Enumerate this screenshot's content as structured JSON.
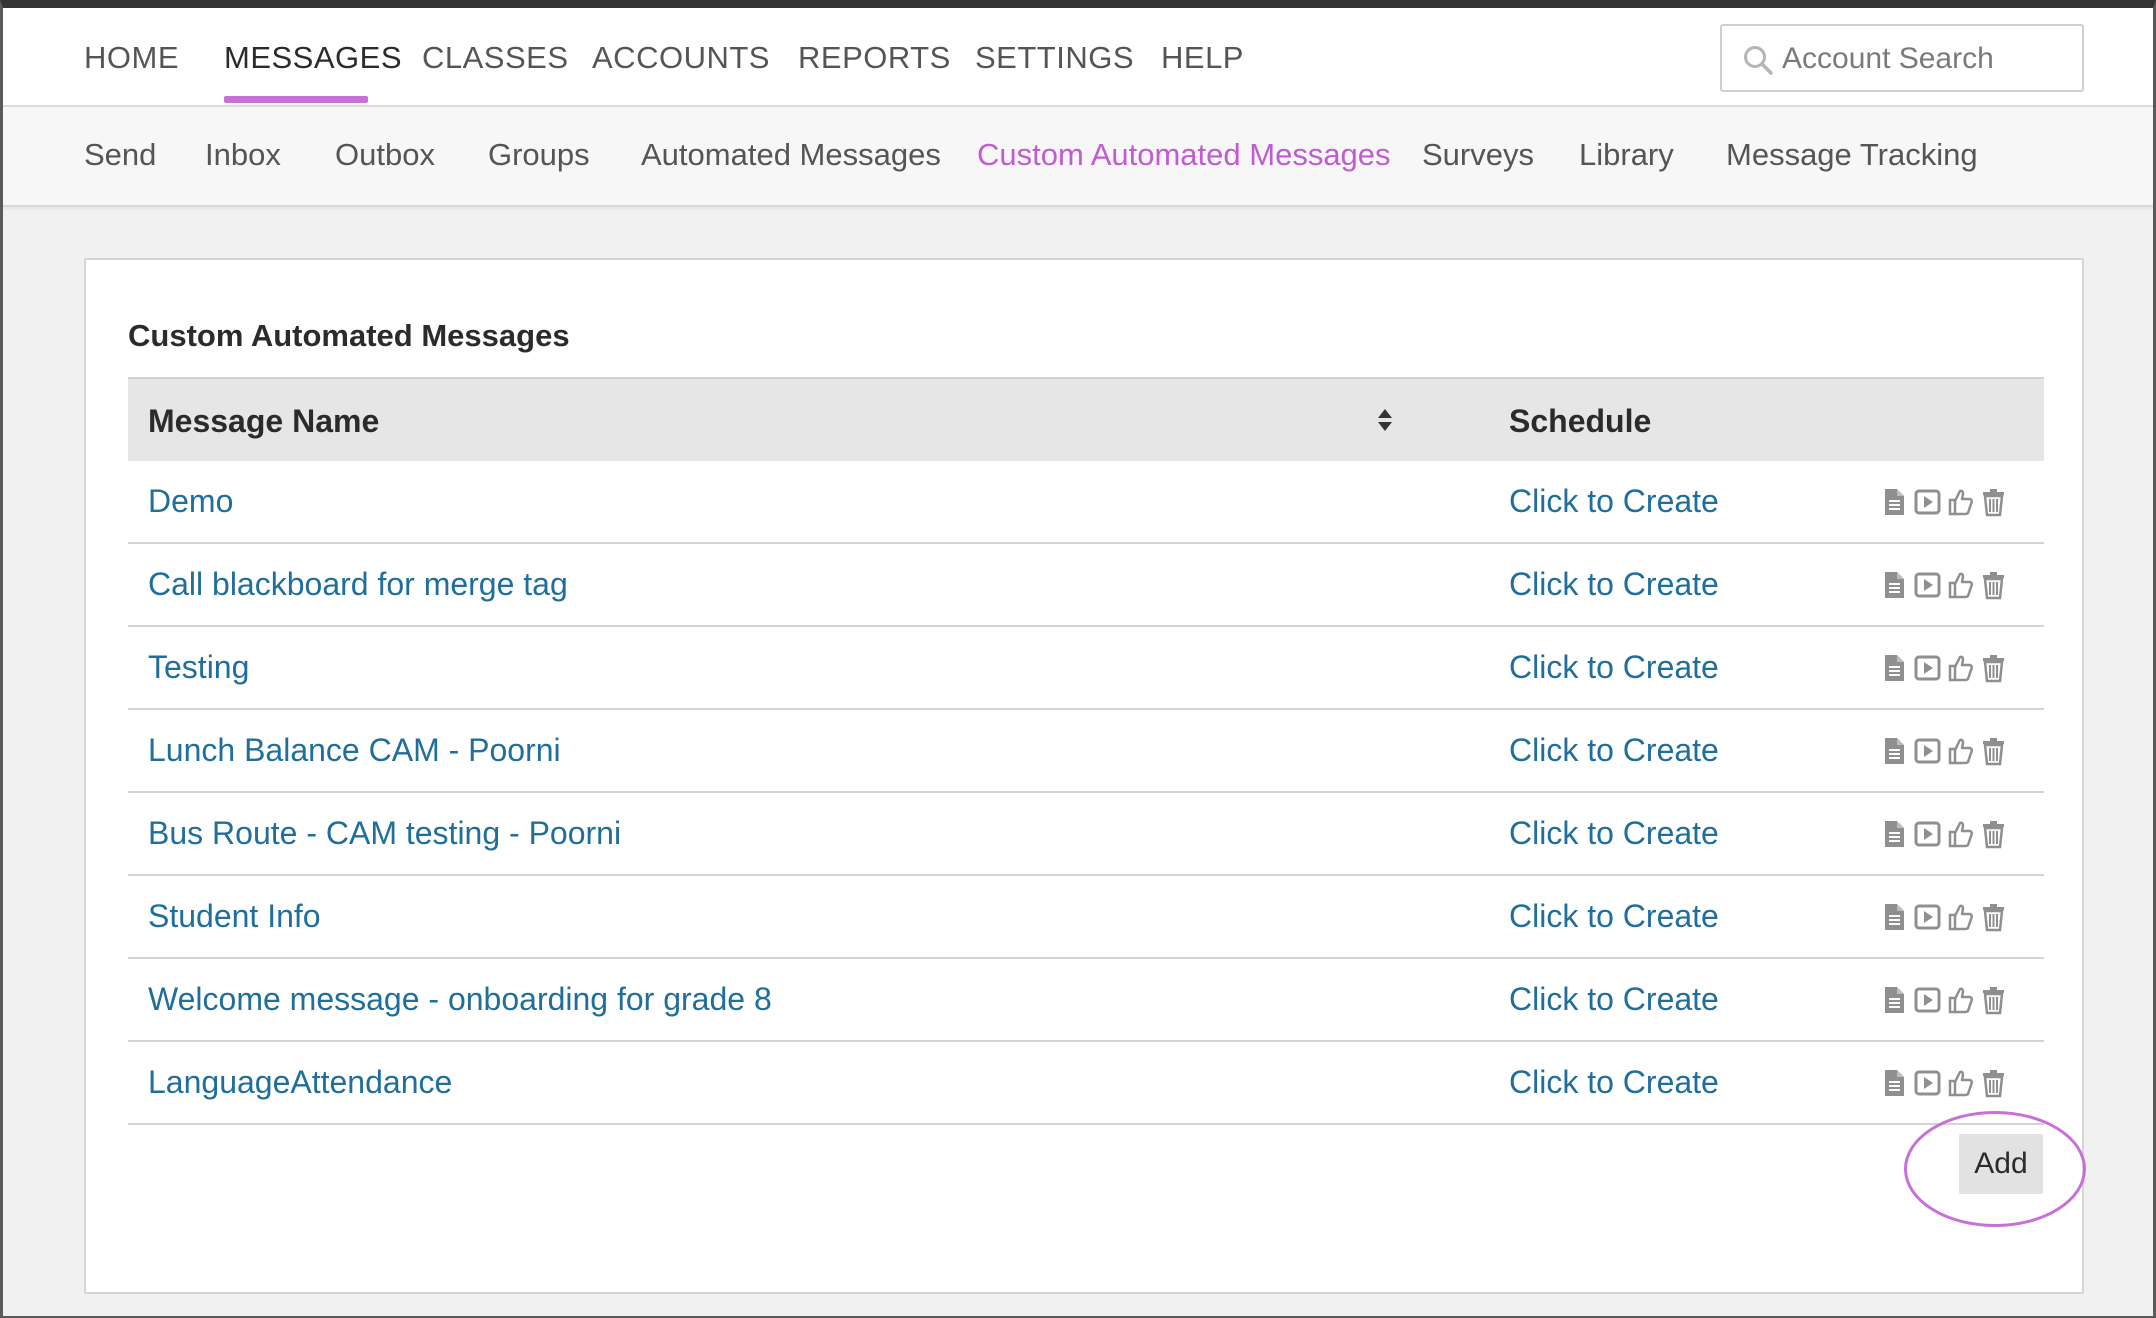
{
  "topnav": {
    "items": [
      {
        "label": "HOME",
        "active": false
      },
      {
        "label": "MESSAGES",
        "active": true
      },
      {
        "label": "CLASSES",
        "active": false
      },
      {
        "label": "ACCOUNTS",
        "active": false
      },
      {
        "label": "REPORTS",
        "active": false
      },
      {
        "label": "SETTINGS",
        "active": false
      },
      {
        "label": "HELP",
        "active": false
      }
    ],
    "search": {
      "placeholder": "Account Search",
      "icon": "search-icon"
    }
  },
  "subnav": {
    "items": [
      {
        "label": "Send",
        "active": false
      },
      {
        "label": "Inbox",
        "active": false
      },
      {
        "label": "Outbox",
        "active": false
      },
      {
        "label": "Groups",
        "active": false
      },
      {
        "label": "Automated Messages",
        "active": false
      },
      {
        "label": "Custom Automated Messages",
        "active": true
      },
      {
        "label": "Surveys",
        "active": false
      },
      {
        "label": "Library",
        "active": false
      },
      {
        "label": "Message Tracking",
        "active": false
      }
    ]
  },
  "panel": {
    "title": "Custom Automated Messages",
    "columns": {
      "name": "Message Name",
      "schedule": "Schedule"
    },
    "rows": [
      {
        "name": "Demo",
        "schedule": "Click to Create"
      },
      {
        "name": "Call blackboard for merge tag",
        "schedule": "Click to Create"
      },
      {
        "name": "Testing",
        "schedule": "Click to Create"
      },
      {
        "name": "Lunch Balance CAM - Poorni",
        "schedule": "Click to Create"
      },
      {
        "name": "Bus Route - CAM testing - Poorni",
        "schedule": "Click to Create"
      },
      {
        "name": "Student Info",
        "schedule": "Click to Create"
      },
      {
        "name": "Welcome message - onboarding for grade 8",
        "schedule": "Click to Create"
      },
      {
        "name": "LanguageAttendance",
        "schedule": "Click to Create"
      }
    ],
    "row_icons": [
      "document-icon",
      "play-icon",
      "thumbs-up-icon",
      "trash-icon"
    ],
    "add_label": "Add"
  },
  "colors": {
    "accent": "#c86fd8",
    "active_subnav": "#c15bd2",
    "link": "#1f6e9c"
  }
}
